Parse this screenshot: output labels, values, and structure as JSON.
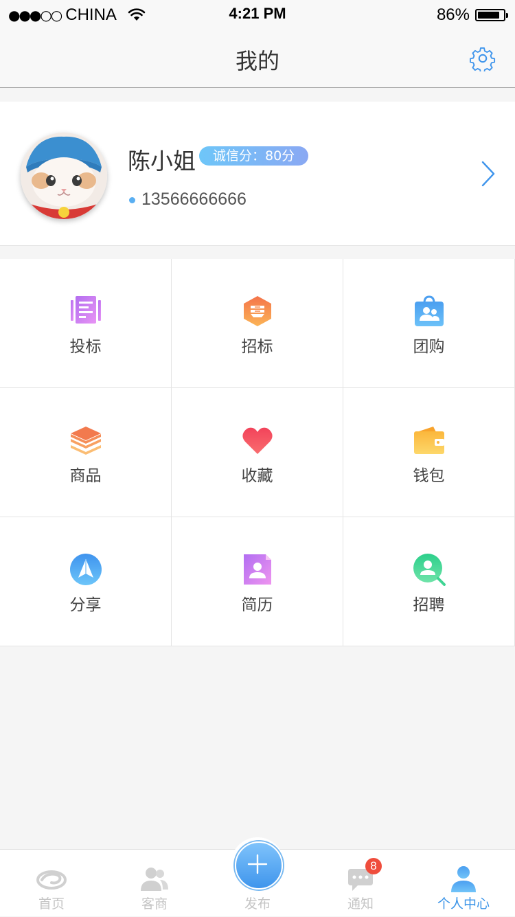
{
  "status_bar": {
    "signal": "●●●○○",
    "carrier": "CHINA",
    "time": "4:21 PM",
    "battery_percent": "86%",
    "battery_level": 0.86
  },
  "navbar": {
    "title": "我的",
    "settings_icon": "gear-icon"
  },
  "profile": {
    "name": "陈小姐",
    "credit_label": "诚信分：80分",
    "phone": "13566666666",
    "avatar_icon": "cat-avatar"
  },
  "grid": [
    {
      "label": "投标",
      "icon": "bid-icon",
      "color": "#c07cf0"
    },
    {
      "label": "招标",
      "icon": "tender-icon",
      "color": "#f5894b"
    },
    {
      "label": "团购",
      "icon": "group-buy-icon",
      "color": "#4aa3f0"
    },
    {
      "label": "商品",
      "icon": "goods-icon",
      "color": "#f6905a"
    },
    {
      "label": "收藏",
      "icon": "heart-icon",
      "color": "#f24f5e"
    },
    {
      "label": "钱包",
      "icon": "wallet-icon",
      "color": "#fbc04a"
    },
    {
      "label": "分享",
      "icon": "share-icon",
      "color": "#4a9ff0"
    },
    {
      "label": "简历",
      "icon": "resume-icon",
      "color": "#c483f1"
    },
    {
      "label": "招聘",
      "icon": "recruit-icon",
      "color": "#3fd493"
    }
  ],
  "tabbar": {
    "items": [
      {
        "label": "首页",
        "icon": "home-icon"
      },
      {
        "label": "客商",
        "icon": "contacts-icon"
      },
      {
        "label": "发布",
        "icon": "plus-icon"
      },
      {
        "label": "通知",
        "icon": "message-icon",
        "badge": "8"
      },
      {
        "label": "个人中心",
        "icon": "user-icon",
        "active": true
      }
    ]
  }
}
